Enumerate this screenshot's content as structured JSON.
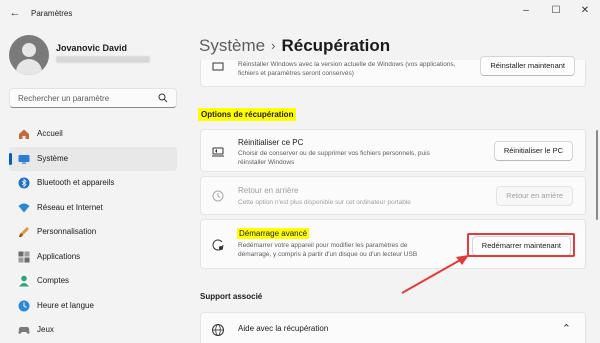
{
  "app": {
    "title": "Paramètres"
  },
  "user": {
    "name": "Jovanovic David"
  },
  "search": {
    "placeholder": "Rechercher un paramètre"
  },
  "sidebar": {
    "items": [
      {
        "label": "Accueil",
        "icon": "home-icon"
      },
      {
        "label": "Système",
        "icon": "system-icon",
        "active": true
      },
      {
        "label": "Bluetooth et appareils",
        "icon": "bluetooth-icon"
      },
      {
        "label": "Réseau et Internet",
        "icon": "network-icon"
      },
      {
        "label": "Personnalisation",
        "icon": "brush-icon"
      },
      {
        "label": "Applications",
        "icon": "apps-icon"
      },
      {
        "label": "Comptes",
        "icon": "accounts-icon"
      },
      {
        "label": "Heure et langue",
        "icon": "time-language-icon"
      },
      {
        "label": "Jeux",
        "icon": "games-icon"
      }
    ]
  },
  "breadcrumb": {
    "parent": "Système",
    "separator": "›",
    "current": "Récupération"
  },
  "top_card": {
    "desc1": "Réinstaller Windows avec la version actuelle de Windows (vos applications,",
    "desc2": "fichiers et paramètres seront conservés)",
    "button": "Réinstaller maintenant"
  },
  "recovery_options": {
    "heading": "Options de récupération",
    "reset": {
      "title": "Réinitialiser ce PC",
      "desc1": "Choisir de conserver ou de supprimer vos fichiers personnels, puis",
      "desc2": "réinstaller Windows",
      "button": "Réinitialiser le PC"
    },
    "goback": {
      "title": "Retour en arrière",
      "desc": "Cette option n'est plus disponible sur cet ordinateur portable",
      "button": "Retour en arrière"
    },
    "advanced": {
      "title": "Démarrage avancé",
      "desc1": "Redémarrer votre appareil pour modifier les paramètres de",
      "desc2": "démarrage, y compris à partir d'un disque ou d'un lecteur USB",
      "button": "Redémarrer maintenant"
    }
  },
  "support": {
    "heading": "Support associé",
    "item": "Aide avec la récupération"
  },
  "colors": {
    "accent": "#005fb8",
    "highlight": "#ffff00",
    "annotation": "#e23b3b"
  }
}
